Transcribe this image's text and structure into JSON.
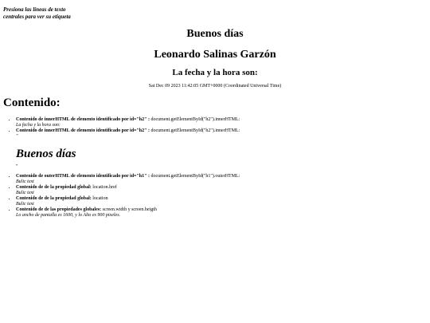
{
  "hint": {
    "line1": "Presiona las líneas de texto",
    "line2": "centrales para ver su etiqueta"
  },
  "header": {
    "greeting": "Buenos días",
    "name": "Leonardo Salinas Garzón",
    "date_label": "La fecha y la hora son:",
    "datetime": "Sat Dec 09 2023 11:42:05 GMT+0000 (Coordinated Universal Time)"
  },
  "content": {
    "title": "Contenido:",
    "list1": [
      {
        "label": "Contenido de innerHTML de elemento identificado por id=\"h2\" :",
        "code": " document.getElementById(\"h2\").innerHTML:",
        "value": "La fecha y la hora son:"
      },
      {
        "label": "Contenido de innerHTML de elemento identificado por id=\"h2\" :",
        "code": " document.getElementById(\"h2\").innerHTML:",
        "value": "\""
      }
    ],
    "big_italic": "Buenos días",
    "small_mark": "\"",
    "list2": [
      {
        "label": "Contenido de outerHTML de elemento identificado por id=\"h1\" :",
        "code": " document.getElementById(\"h1\").outerHTML:",
        "value": "Bulic text"
      },
      {
        "label": "Contenido de de la propiedad global:",
        "code": " location.href",
        "value": "Bulic text"
      },
      {
        "label": "Contenido de de la propiedad global:",
        "code": " location",
        "value": "Bulic text"
      },
      {
        "label": "Contenido de de las propiedades globales:",
        "code": " screen.width y screen.heigth",
        "value": "Lo ancho de pantalla es 1600, y lo Alto es 900 pixeles."
      }
    ]
  }
}
